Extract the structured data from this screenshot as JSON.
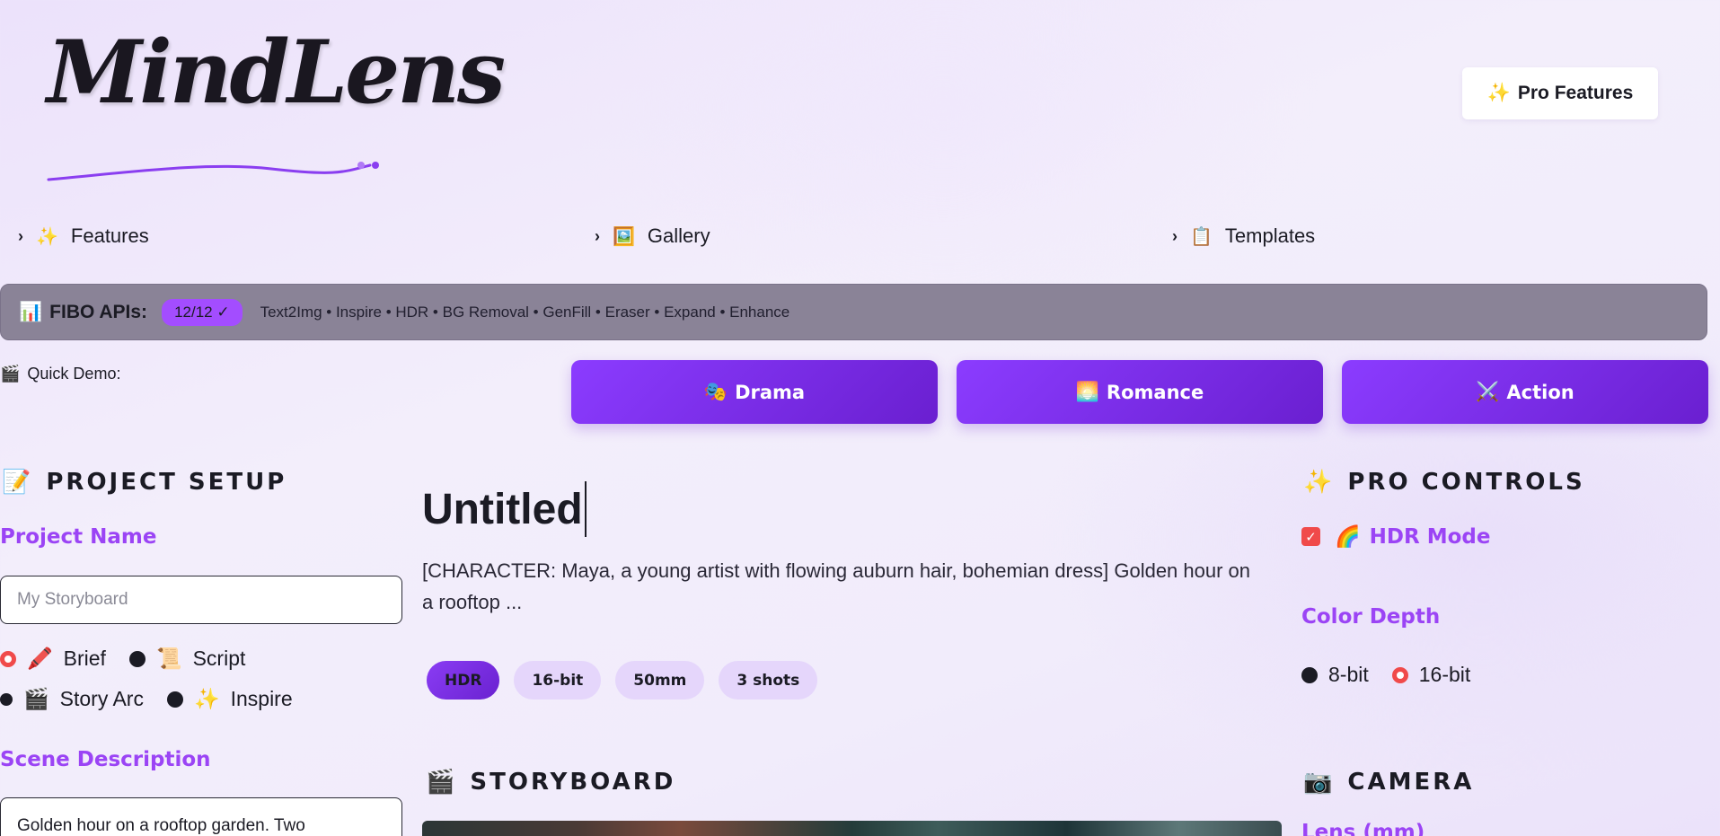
{
  "logo": {
    "text": "MindLens"
  },
  "header": {
    "pro_button": "Pro Features",
    "pro_icon": "✨"
  },
  "nav": [
    {
      "icon": "✨",
      "label": "Features"
    },
    {
      "icon": "🖼️",
      "label": "Gallery"
    },
    {
      "icon": "📋",
      "label": "Templates"
    }
  ],
  "api_bar": {
    "icon": "📊",
    "label": "FIBO APIs:",
    "badge": "12/12 ✓",
    "list": "Text2Img • Inspire • HDR • BG Removal • GenFill • Eraser • Expand • Enhance"
  },
  "quick_demo": {
    "icon": "🎬",
    "label": "Quick Demo:",
    "buttons": [
      {
        "icon": "🎭",
        "label": "Drama"
      },
      {
        "icon": "🌅",
        "label": "Romance"
      },
      {
        "icon": "⚔️",
        "label": "Action"
      }
    ]
  },
  "project_setup": {
    "icon": "📝",
    "title": "PROJECT SETUP",
    "name_label": "Project Name",
    "name_placeholder": "My Storyboard",
    "modes": [
      {
        "icon": "🖍️",
        "label": "Brief",
        "selected": true
      },
      {
        "icon": "📜",
        "label": "Script",
        "selected": false
      },
      {
        "icon": "🎬",
        "label": "Story Arc",
        "selected": false
      },
      {
        "icon": "✨",
        "label": "Inspire",
        "selected": false
      }
    ],
    "scene_label": "Scene Description",
    "scene_value": "Golden hour on a rooftop garden. Two"
  },
  "document": {
    "title": "Untitled",
    "description": "[CHARACTER: Maya, a young artist with flowing auburn hair, bohemian dress] Golden hour on a rooftop ...",
    "chips": [
      {
        "label": "HDR",
        "active": true
      },
      {
        "label": "16-bit",
        "active": false
      },
      {
        "label": "50mm",
        "active": false
      },
      {
        "label": "3 shots",
        "active": false
      }
    ]
  },
  "storyboard": {
    "icon": "🎬",
    "title": "STORYBOARD"
  },
  "pro_controls": {
    "icon": "✨",
    "title": "PRO CONTROLS",
    "hdr_checked": true,
    "hdr_icon": "🌈",
    "hdr_label": "HDR Mode",
    "color_depth_label": "Color Depth",
    "depth_options": [
      {
        "label": "8-bit",
        "selected": false
      },
      {
        "label": "16-bit",
        "selected": true
      }
    ]
  },
  "camera": {
    "icon": "📷",
    "title": "CAMERA",
    "lens_label": "Lens (mm)"
  },
  "colors": {
    "accent": "#9b44f5",
    "button_start": "#8b3cff",
    "button_end": "#6a1fd0",
    "api_bar": "#8a8397",
    "radio_on": "#f04a4a"
  }
}
